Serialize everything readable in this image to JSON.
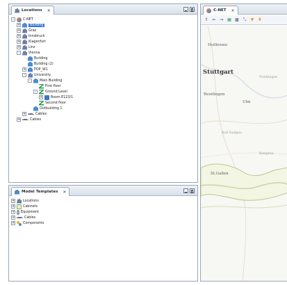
{
  "locations_panel": {
    "title": "Locations",
    "tree": [
      {
        "label": "C-NET",
        "depth": 0,
        "icon": "network",
        "expander": "-"
      },
      {
        "label": "Building",
        "depth": 1,
        "icon": "building",
        "expander": "+",
        "selected": true
      },
      {
        "label": "Graz",
        "depth": 1,
        "icon": "location",
        "expander": "+"
      },
      {
        "label": "Innsbruck",
        "depth": 1,
        "icon": "location",
        "expander": "+"
      },
      {
        "label": "Klagenfurt",
        "depth": 1,
        "icon": "location",
        "expander": "+"
      },
      {
        "label": "Linz",
        "depth": 1,
        "icon": "location",
        "expander": "+"
      },
      {
        "label": "Vienna",
        "depth": 1,
        "icon": "location",
        "expander": "-"
      },
      {
        "label": "Building",
        "depth": 2,
        "icon": "building",
        "expander": ""
      },
      {
        "label": "Building (2)",
        "depth": 2,
        "icon": "building",
        "expander": ""
      },
      {
        "label": "POP_W1",
        "depth": 2,
        "icon": "building",
        "expander": "+"
      },
      {
        "label": "University",
        "depth": 2,
        "icon": "location",
        "expander": "-"
      },
      {
        "label": "Main Building",
        "depth": 3,
        "icon": "building",
        "expander": "-"
      },
      {
        "label": "First floor",
        "depth": 4,
        "icon": "floor",
        "expander": ""
      },
      {
        "label": "Ground Level",
        "depth": 4,
        "icon": "floor",
        "expander": "-"
      },
      {
        "label": "Room E123/1",
        "depth": 5,
        "icon": "room",
        "expander": "+"
      },
      {
        "label": "Second floor",
        "depth": 4,
        "icon": "floor",
        "expander": ""
      },
      {
        "label": "Outbuilding 1",
        "depth": 3,
        "icon": "building",
        "expander": ""
      },
      {
        "label": "Cables",
        "depth": 2,
        "icon": "cable",
        "expander": "+"
      },
      {
        "label": "Cables",
        "depth": 1,
        "icon": "cable",
        "expander": "+"
      }
    ]
  },
  "templates_panel": {
    "title": "Model Templates",
    "tree": [
      {
        "label": "Locations",
        "depth": 0,
        "icon": "location",
        "expander": "+"
      },
      {
        "label": "Cabinets",
        "depth": 0,
        "icon": "cabinet",
        "expander": "+"
      },
      {
        "label": "Equipment",
        "depth": 0,
        "icon": "equipment",
        "expander": "+"
      },
      {
        "label": "Cables",
        "depth": 0,
        "icon": "cable",
        "expander": "+"
      },
      {
        "label": "Components",
        "depth": 0,
        "icon": "component",
        "expander": "+"
      }
    ]
  },
  "map_panel": {
    "title": "C-NET",
    "toolbar": [
      {
        "name": "home-icon",
        "glyph": "⇑",
        "tone": ""
      },
      {
        "name": "back-icon",
        "glyph": "⇐",
        "tone": ""
      },
      {
        "name": "forward-icon",
        "glyph": "⇒",
        "tone": ""
      },
      {
        "name": "map-layers-icon",
        "glyph": "▦",
        "tone": "c4"
      },
      {
        "name": "grid-icon",
        "glyph": "▩",
        "tone": ""
      },
      {
        "name": "measure-icon",
        "glyph": "⤡",
        "tone": ""
      },
      {
        "name": "filter-icon",
        "glyph": "▼",
        "tone": "c3"
      },
      {
        "name": "lock-icon",
        "glyph": "♜",
        "tone": "c3"
      }
    ],
    "places": [
      {
        "name": "Heilbronn",
        "cls": ""
      },
      {
        "name": "Stuttgart",
        "cls": "big"
      },
      {
        "name": "Reutlingen",
        "cls": ""
      },
      {
        "name": "Ulm",
        "cls": ""
      },
      {
        "name": "Bad Saulgau",
        "cls": "faint"
      },
      {
        "name": "St.Gallen",
        "cls": ""
      },
      {
        "name": "Nordlingen",
        "cls": "faint"
      },
      {
        "name": "Kempten",
        "cls": "faint"
      }
    ]
  }
}
